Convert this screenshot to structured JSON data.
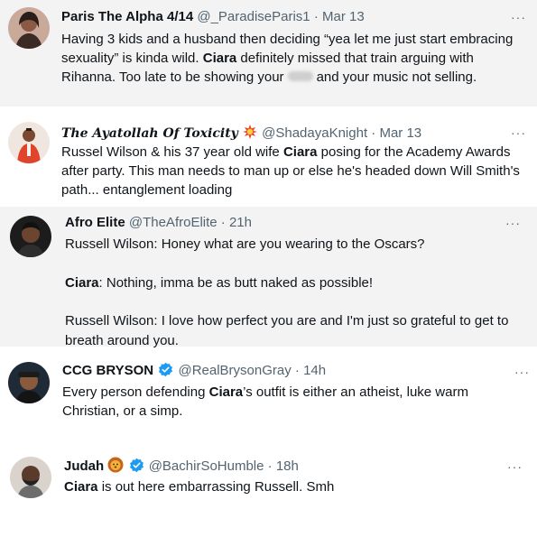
{
  "tweets": [
    {
      "name": "Paris The Alpha 4/14",
      "handle": "@_ParadiseParis1",
      "sep": "·",
      "time": "Mar 13",
      "more": "···",
      "text1": "Having 3 kids and a husband then deciding “yea let me just start embracing sexuality” is kinda wild. ",
      "bold1": "Ciara",
      "text2": " definitely missed that train arguing with Rihanna. Too late to be showing your",
      "text3": "and your music not selling."
    },
    {
      "name": "The Ayatollah Of Toxicity",
      "handle": "@ShadayaKnight",
      "sep": "·",
      "time": "Mar 13",
      "more": "···",
      "text1": "Russel Wilson & his 37 year old wife ",
      "bold1": "Ciara",
      "text2": " posing for the Academy Awards after party. This man needs to man up or else he's headed down Will Smith's path... entanglement loading"
    },
    {
      "name": "Afro Elite",
      "handle": "@TheAfroElite",
      "sep": "·",
      "time": "21h",
      "more": "···",
      "line1": "Russell Wilson: Honey what are you wearing to the Oscars?",
      "bold1": "Ciara",
      "line2": ": Nothing, imma be as butt naked as possible!",
      "line3": "Russell Wilson: I love how perfect you are and I'm just so grateful to get to breath around you."
    },
    {
      "name": "CCG BRYSON",
      "handle": "@RealBrysonGray",
      "sep": "·",
      "time": "14h",
      "more": "···",
      "text1": "Every person defending ",
      "bold1": "Ciara",
      "text2": "’s outfit is either an atheist, luke warm Christian, or a simp."
    },
    {
      "name": "Judah",
      "handle": "@BachirSoHumble",
      "sep": "·",
      "time": "18h",
      "more": "···",
      "bold1": "Ciara",
      "text1": " is out here embarrassing Russell. Smh"
    }
  ],
  "icons": {
    "verified": "verified-badge-icon",
    "fire": "fire-emoji-icon",
    "lion": "lion-emoji-icon",
    "more": "more-options-icon"
  },
  "colors": {
    "text": "#0f1419",
    "muted": "#536471",
    "verified": "#1d9bf0",
    "card_gray": "#f3f3f3"
  }
}
